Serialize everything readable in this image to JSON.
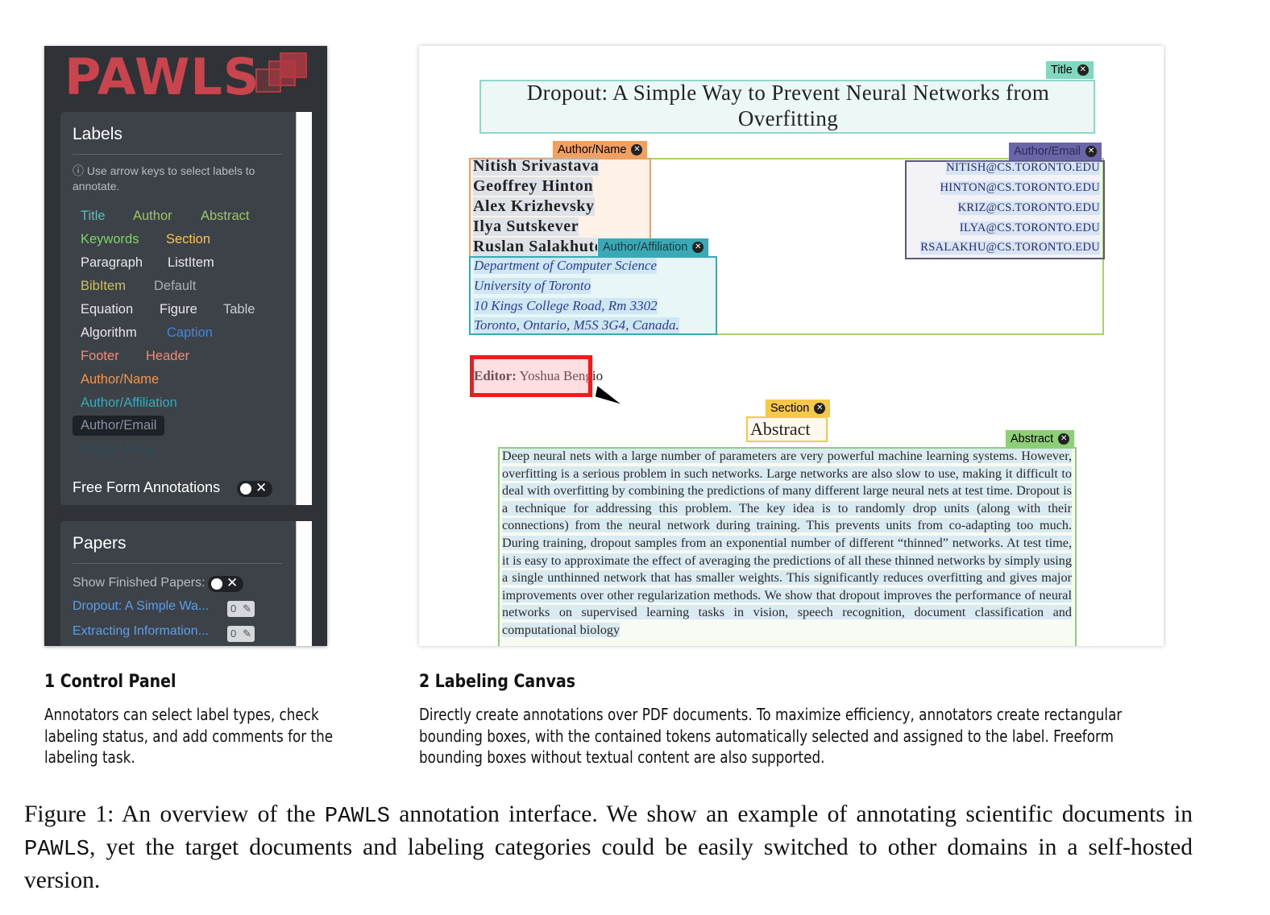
{
  "control_panel": {
    "logo": "PAWLS",
    "labels_card": {
      "title": "Labels",
      "hint": "Use arrow keys to select labels to annotate.",
      "labels": [
        {
          "text": "Title",
          "color": "#4fc6b6"
        },
        {
          "text": "Author",
          "color": "#9bc468"
        },
        {
          "text": "Abstract",
          "color": "#9bc468"
        },
        {
          "text": "Keywords",
          "color": "#7fd36a"
        },
        {
          "text": "Section",
          "color": "#f5c84a"
        },
        {
          "text": "Paragraph",
          "color": "#e8e8e8"
        },
        {
          "text": "ListItem",
          "color": "#e8e8e8"
        },
        {
          "text": "BibItem",
          "color": "#c8c06a"
        },
        {
          "text": "Default",
          "color": "#a9aeb3"
        },
        {
          "text": "Equation",
          "color": "#e8e8e8"
        },
        {
          "text": "Figure",
          "color": "#e8e8e8"
        },
        {
          "text": "Table",
          "color": "#c9ced3"
        },
        {
          "text": "Algorithm",
          "color": "#e8e8e8"
        },
        {
          "text": "Caption",
          "color": "#3f86e0"
        },
        {
          "text": "Footer",
          "color": "#f08a7a"
        },
        {
          "text": "Header",
          "color": "#f08a7a"
        },
        {
          "text": "Author/Name",
          "color": "#f0944a"
        },
        {
          "text": "Author/Affiliation",
          "color": "#3aa9b6"
        },
        {
          "text": "Author/Email",
          "color": "#8a8fa0"
        },
        {
          "text": "Paper/Venue",
          "color": "#2c4d54"
        }
      ],
      "free_form_label": "Free Form Annotations",
      "toggle_x": "✕"
    },
    "papers_card": {
      "title": "Papers",
      "show_finished_label": "Show Finished Papers:",
      "toggle_x": "✕",
      "papers": [
        {
          "title": "Dropout: A Simple Wa...",
          "count": "0"
        },
        {
          "title": "Extracting Information...",
          "count": "0"
        }
      ]
    }
  },
  "canvas": {
    "tags": {
      "title": "Title",
      "author_name": "Author/Name",
      "author_email": "Author/Email",
      "author_affiliation": "Author/Affiliation",
      "section": "Section",
      "abstract": "Abstract"
    },
    "paper_title": "Dropout: A Simple Way to Prevent Neural Networks from Overfitting",
    "authors": [
      "Nitish Srivastava",
      "Geoffrey Hinton",
      "Alex Krizhevsky",
      "Ilya Sutskever",
      "Ruslan Salakhutdinov"
    ],
    "emails": [
      "NITISH@CS.TORONTO.EDU",
      "HINTON@CS.TORONTO.EDU",
      "KRIZ@CS.TORONTO.EDU",
      "ILYA@CS.TORONTO.EDU",
      "RSALAKHU@CS.TORONTO.EDU"
    ],
    "affiliation": [
      "Department of Computer Science",
      "University of Toronto",
      "10 Kings College Road, Rm 3302",
      "Toronto, Ontario, M5S 3G4, Canada."
    ],
    "editor_label": "Editor:",
    "editor_name": "Yoshua Bengio",
    "abstract_heading": "Abstract",
    "abstract_text": "Deep neural nets with a large number of parameters are very powerful machine learning systems. However, overfitting is a serious problem in such networks. Large networks are also slow to use, making it difficult to deal with overfitting by combining the predictions of many different large neural nets at test time. Dropout is a technique for addressing this problem. The key idea is to randomly drop units (along with their connections) from the neural network during training. This prevents units from co-adapting too much. During training, dropout samples from an exponential number of different “thinned” networks. At test time, it is easy to approximate the effect of averaging the predictions of all these thinned networks by simply using a single unthinned network that has smaller weights. This significantly reduces overfitting and gives major improvements over other regularization methods. We show that dropout improves the performance of neural networks on supervised learning tasks in vision, speech recognition, document classification and computational biology"
  },
  "captions": {
    "panel_title": "1 Control Panel",
    "panel_desc": "Annotators can select label types, check labeling status, and add comments for the labeling task.",
    "canvas_title": "2 Labeling Canvas",
    "canvas_desc": "Directly create annotations over PDF documents. To maximize efficiency, annotators create rectangular bounding boxes, with the contained tokens automatically selected and assigned to the label. Freeform bounding boxes without textual content are also supported.",
    "figure": {
      "prefix": "Figure 1: An overview of the",
      "code1": "PAWLS",
      "middle": "annotation interface. We show an example of annotating scientific documents in",
      "code2": "PAWLS",
      "suffix": ", yet the target documents and labeling categories could be easily switched to other domains in a self-hosted version."
    }
  }
}
